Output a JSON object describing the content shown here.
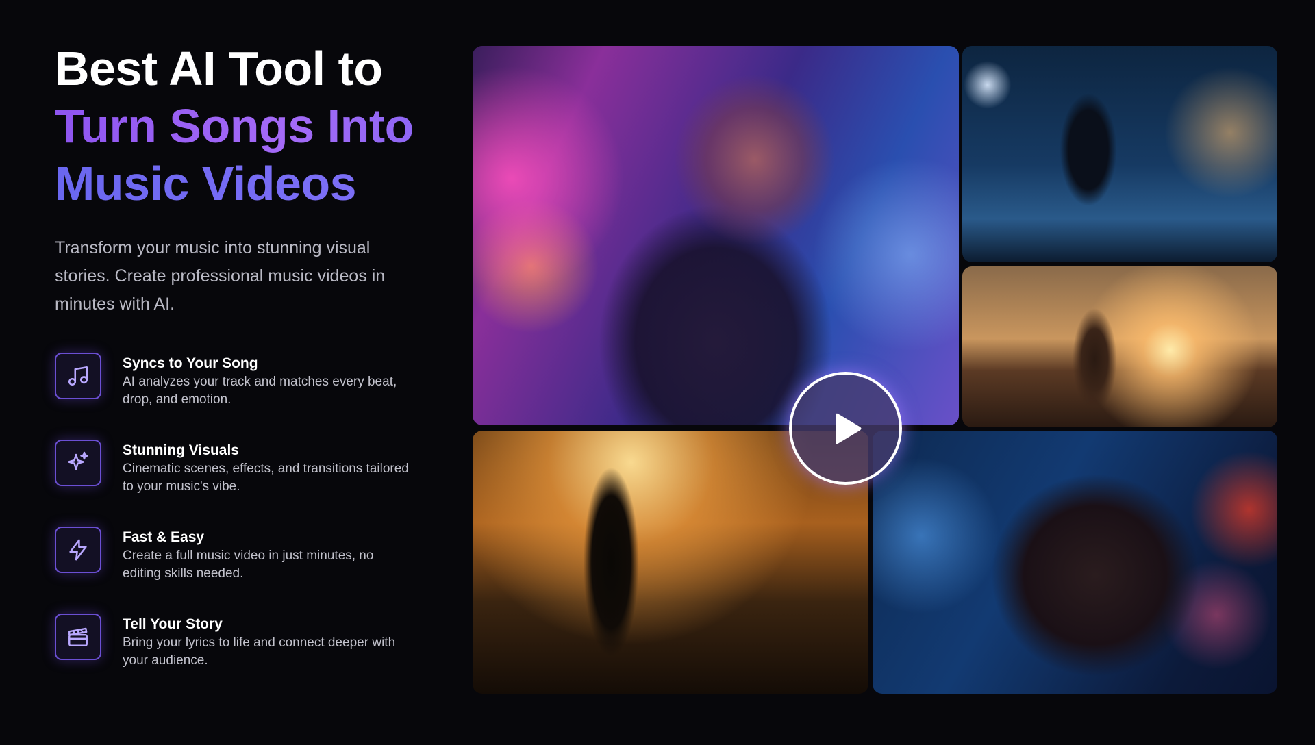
{
  "hero": {
    "headline": {
      "line1": "Best AI Tool to",
      "line2": "Turn Songs Into",
      "line3": "Music Videos"
    },
    "description": "Transform your music into stunning visual stories. Create professional music videos in minutes with AI."
  },
  "features": [
    {
      "icon": "music-note-icon",
      "title": "Syncs to Your Song",
      "description": "AI analyzes your track and matches every beat, drop, and emotion."
    },
    {
      "icon": "sparkle-icon",
      "title": "Stunning Visuals",
      "description": "Cinematic scenes, effects, and transitions tailored to your music's vibe."
    },
    {
      "icon": "lightning-icon",
      "title": "Fast & Easy",
      "description": "Create a full music video in just minutes, no editing skills needed."
    },
    {
      "icon": "clapperboard-icon",
      "title": "Tell Your Story",
      "description": "Bring your lyrics to life and connect deeper with your audience."
    }
  ],
  "gallery": {
    "play_icon": "play-icon"
  },
  "colors": {
    "background": "#07070b",
    "accent_purple": "#9b5cf6",
    "accent_indigo": "#6a67f0",
    "icon_border": "#6b4fd3"
  }
}
